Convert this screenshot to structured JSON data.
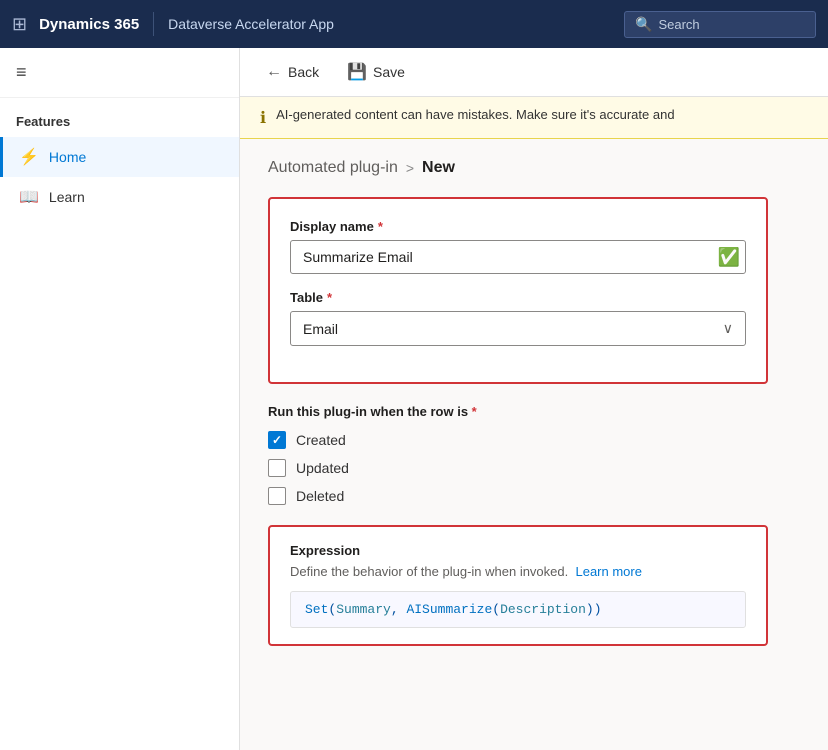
{
  "topNav": {
    "gridIcon": "⊞",
    "title": "Dynamics 365",
    "appName": "Dataverse Accelerator App",
    "searchPlaceholder": "Search",
    "searchIcon": "🔍"
  },
  "sidebar": {
    "hamburgerIcon": "≡",
    "sectionTitle": "Features",
    "items": [
      {
        "id": "home",
        "label": "Home",
        "icon": "⚡",
        "active": true
      },
      {
        "id": "learn",
        "label": "Learn",
        "icon": "📖",
        "active": false
      }
    ]
  },
  "toolbar": {
    "backLabel": "Back",
    "backIcon": "←",
    "saveLabel": "Save",
    "saveIcon": "💾"
  },
  "alertBanner": {
    "icon": "ℹ",
    "text": "AI-generated content can have mistakes. Make sure it's accurate and"
  },
  "breadcrumb": {
    "parent": "Automated plug-in",
    "separator": ">",
    "current": "New"
  },
  "form": {
    "displayNameLabel": "Display name",
    "displayNameValue": "Summarize Email",
    "tableLabel": "Table",
    "tableValue": "Email"
  },
  "runSection": {
    "label": "Run this plug-in when the row is",
    "options": [
      {
        "id": "created",
        "label": "Created",
        "checked": true
      },
      {
        "id": "updated",
        "label": "Updated",
        "checked": false
      },
      {
        "id": "deleted",
        "label": "Deleted",
        "checked": false
      }
    ]
  },
  "expression": {
    "title": "Expression",
    "description": "Define the behavior of the plug-in when invoked.",
    "linkText": "Learn more",
    "codeText": "Set(Summary, AISummarize(Description))"
  }
}
